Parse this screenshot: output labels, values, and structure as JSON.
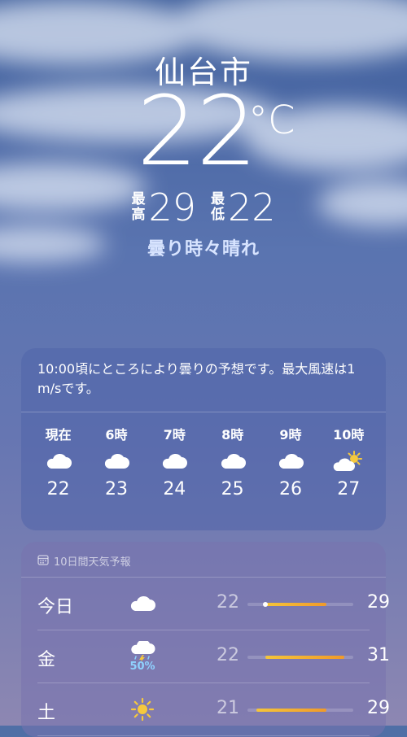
{
  "city": "仙台市",
  "current_temp": "22",
  "temp_unit": "°C",
  "high_label": "最高",
  "high": "29",
  "low_label": "最低",
  "low": "22",
  "condition": "曇り時々晴れ",
  "hourly": {
    "summary": "10:00頃にところにより曇りの予想です。最大風速は1 m/sです。",
    "items": [
      {
        "label": "現在",
        "icon": "cloud-icon",
        "temp": "22"
      },
      {
        "label": "6時",
        "icon": "cloud-icon",
        "temp": "23"
      },
      {
        "label": "7時",
        "icon": "cloud-icon",
        "temp": "24"
      },
      {
        "label": "8時",
        "icon": "cloud-icon",
        "temp": "25"
      },
      {
        "label": "9時",
        "icon": "cloud-icon",
        "temp": "26"
      },
      {
        "label": "10時",
        "icon": "partly-sunny-icon",
        "temp": "27"
      }
    ]
  },
  "daily": {
    "header": "10日間天気予報",
    "header_icon": "calendar-icon",
    "range_min": 20,
    "range_max": 32,
    "rows": [
      {
        "day": "今日",
        "icon": "cloud-icon",
        "pop": "",
        "low": "22",
        "high": "29",
        "current": 22
      },
      {
        "day": "金",
        "icon": "thunderstorm-icon",
        "pop": "50%",
        "low": "22",
        "high": "31"
      },
      {
        "day": "土",
        "icon": "sun-icon",
        "pop": "",
        "low": "21",
        "high": "29"
      }
    ]
  },
  "colors": {
    "accent_bar_start": "#f5c53a",
    "accent_bar_end": "#f09a2a",
    "pop": "#8fd2ff"
  }
}
